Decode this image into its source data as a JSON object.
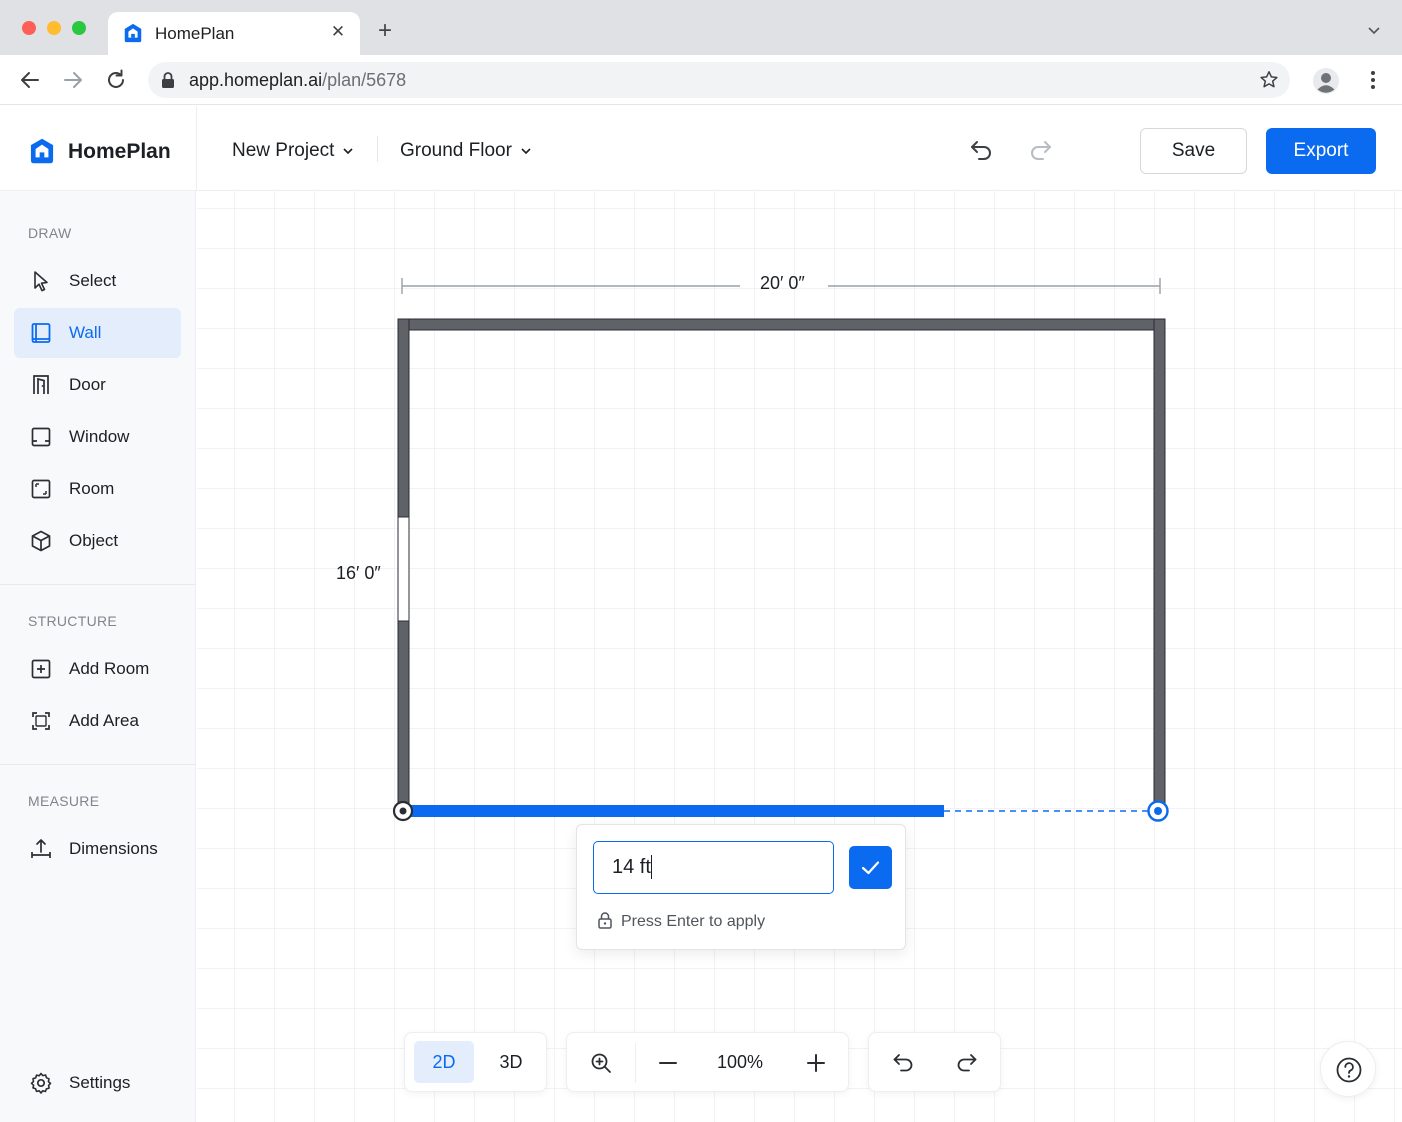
{
  "browser": {
    "tab_title": "HomePlan",
    "url_host": "app.homeplan.ai",
    "url_path": "/plan/5678"
  },
  "header": {
    "brand": "HomePlan",
    "project_dropdown": "New Project",
    "floor_dropdown": "Ground Floor",
    "save_label": "Save",
    "export_label": "Export",
    "accent_color": "#0b6bf0"
  },
  "sidebar": {
    "draw_title": "DRAW",
    "draw_items": [
      {
        "label": "Select",
        "icon": "cursor-icon"
      },
      {
        "label": "Wall",
        "icon": "wall-icon",
        "active": true
      },
      {
        "label": "Door",
        "icon": "door-icon"
      },
      {
        "label": "Window",
        "icon": "window-icon"
      },
      {
        "label": "Room",
        "icon": "room-icon"
      },
      {
        "label": "Object",
        "icon": "cube-icon"
      }
    ],
    "structure_title": "STRUCTURE",
    "structure_items": [
      {
        "label": "Add Room",
        "icon": "plus-square-icon"
      },
      {
        "label": "Add Area",
        "icon": "area-icon"
      }
    ],
    "measure_title": "MEASURE",
    "measure_items": [
      {
        "label": "Dimensions",
        "icon": "dimensions-icon"
      }
    ],
    "settings_label": "Settings"
  },
  "canvas": {
    "width_dimension": "20′ 0″",
    "height_dimension": "16′ 0″",
    "wall_input": {
      "value": "14 ft",
      "hint": "Press Enter to apply"
    }
  },
  "toolbar": {
    "view_2d": "2D",
    "view_3d": "3D",
    "active_view": "2D",
    "zoom": "100%"
  }
}
